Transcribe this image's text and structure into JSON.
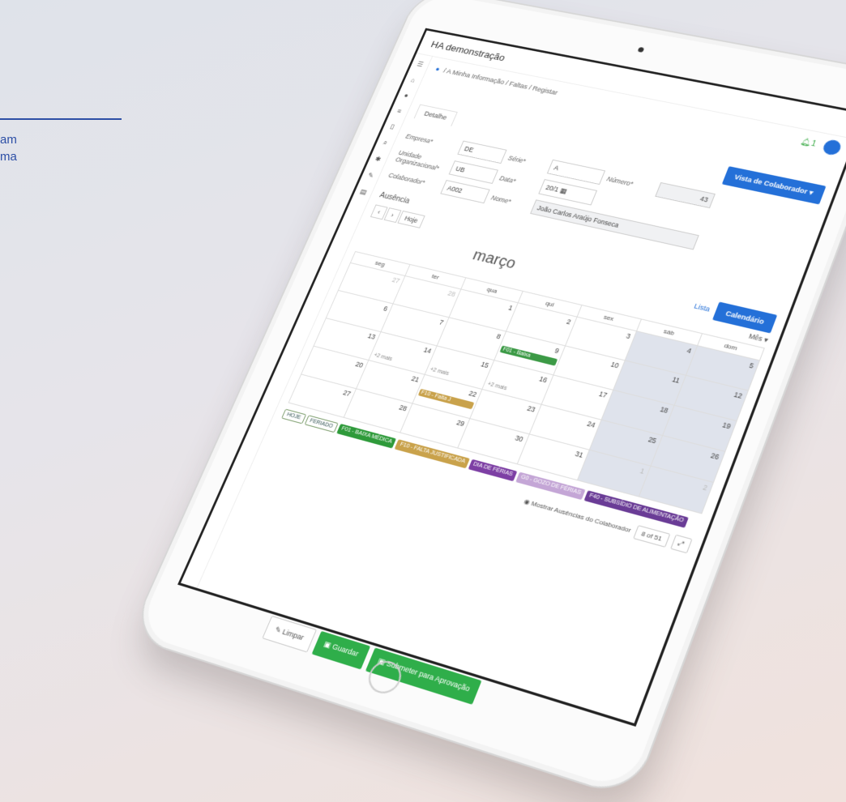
{
  "side": {
    "line_text_1": "am",
    "line_text_2": "ma"
  },
  "app": {
    "title": "HA demonstração"
  },
  "breadcrumb": "/ A Minha Informação / Faltas / Registar",
  "header": {
    "notifications": "1"
  },
  "tabs": {
    "details": "Detalhe"
  },
  "view_button": "Vista de Colaborador",
  "form": {
    "empresa_label": "Empresa*",
    "empresa_value": "DE",
    "serie_label": "Série*",
    "serie_value": "A",
    "numero_label": "Número*",
    "numero_value": "43",
    "unidade_label": "Unidade Organizacional*",
    "unidade_value": "UB",
    "data_label": "Data*",
    "data_value": "20/1",
    "colaborador_label": "Colaborador*",
    "colaborador_value": "A002",
    "nome_label": "Nome*",
    "nome_value": "João Carlos Araújo Fonseca"
  },
  "section": {
    "ausencia": "Ausência"
  },
  "calendar": {
    "month": "março",
    "today": "Hoje",
    "list_link": "Lista",
    "calendar_button": "Calendário",
    "month_select": "Mês",
    "weekdays": [
      "seg",
      "ter",
      "qua",
      "qui",
      "sex",
      "sáb",
      "dom"
    ],
    "weeks": [
      [
        "27",
        "28",
        "1",
        "2",
        "3",
        "4",
        "5"
      ],
      [
        "6",
        "7",
        "8",
        "9",
        "10",
        "11",
        "12"
      ],
      [
        "13",
        "14",
        "15",
        "16",
        "17",
        "18",
        "19"
      ],
      [
        "20",
        "21",
        "22",
        "23",
        "24",
        "25",
        "26"
      ],
      [
        "27",
        "28",
        "29",
        "30",
        "31",
        "1",
        "2"
      ]
    ],
    "events": {
      "baixa": "F01 - Baixa",
      "falta": "F10 - Falta J",
      "more": "+2 mais"
    }
  },
  "legend": [
    "HOJE",
    "FERIADO",
    "F01 - BAIXA MÉDICA",
    "F10 - FALTA JUSTIFICADA",
    "DIA DE FÉRIAS",
    "G0 - GOZO DE FÉRIAS",
    "F40 - SUBSÍDIO DE ALIMENTAÇÃO"
  ],
  "footer": {
    "show_absences": "Mostrar Ausências do Colaborador",
    "pager": "8 of 51",
    "clear": "Limpar",
    "save": "Guardar",
    "submit": "Submeter para Aprovação"
  },
  "colors": {
    "accent": "#2470d8",
    "success": "#2fae4a"
  }
}
